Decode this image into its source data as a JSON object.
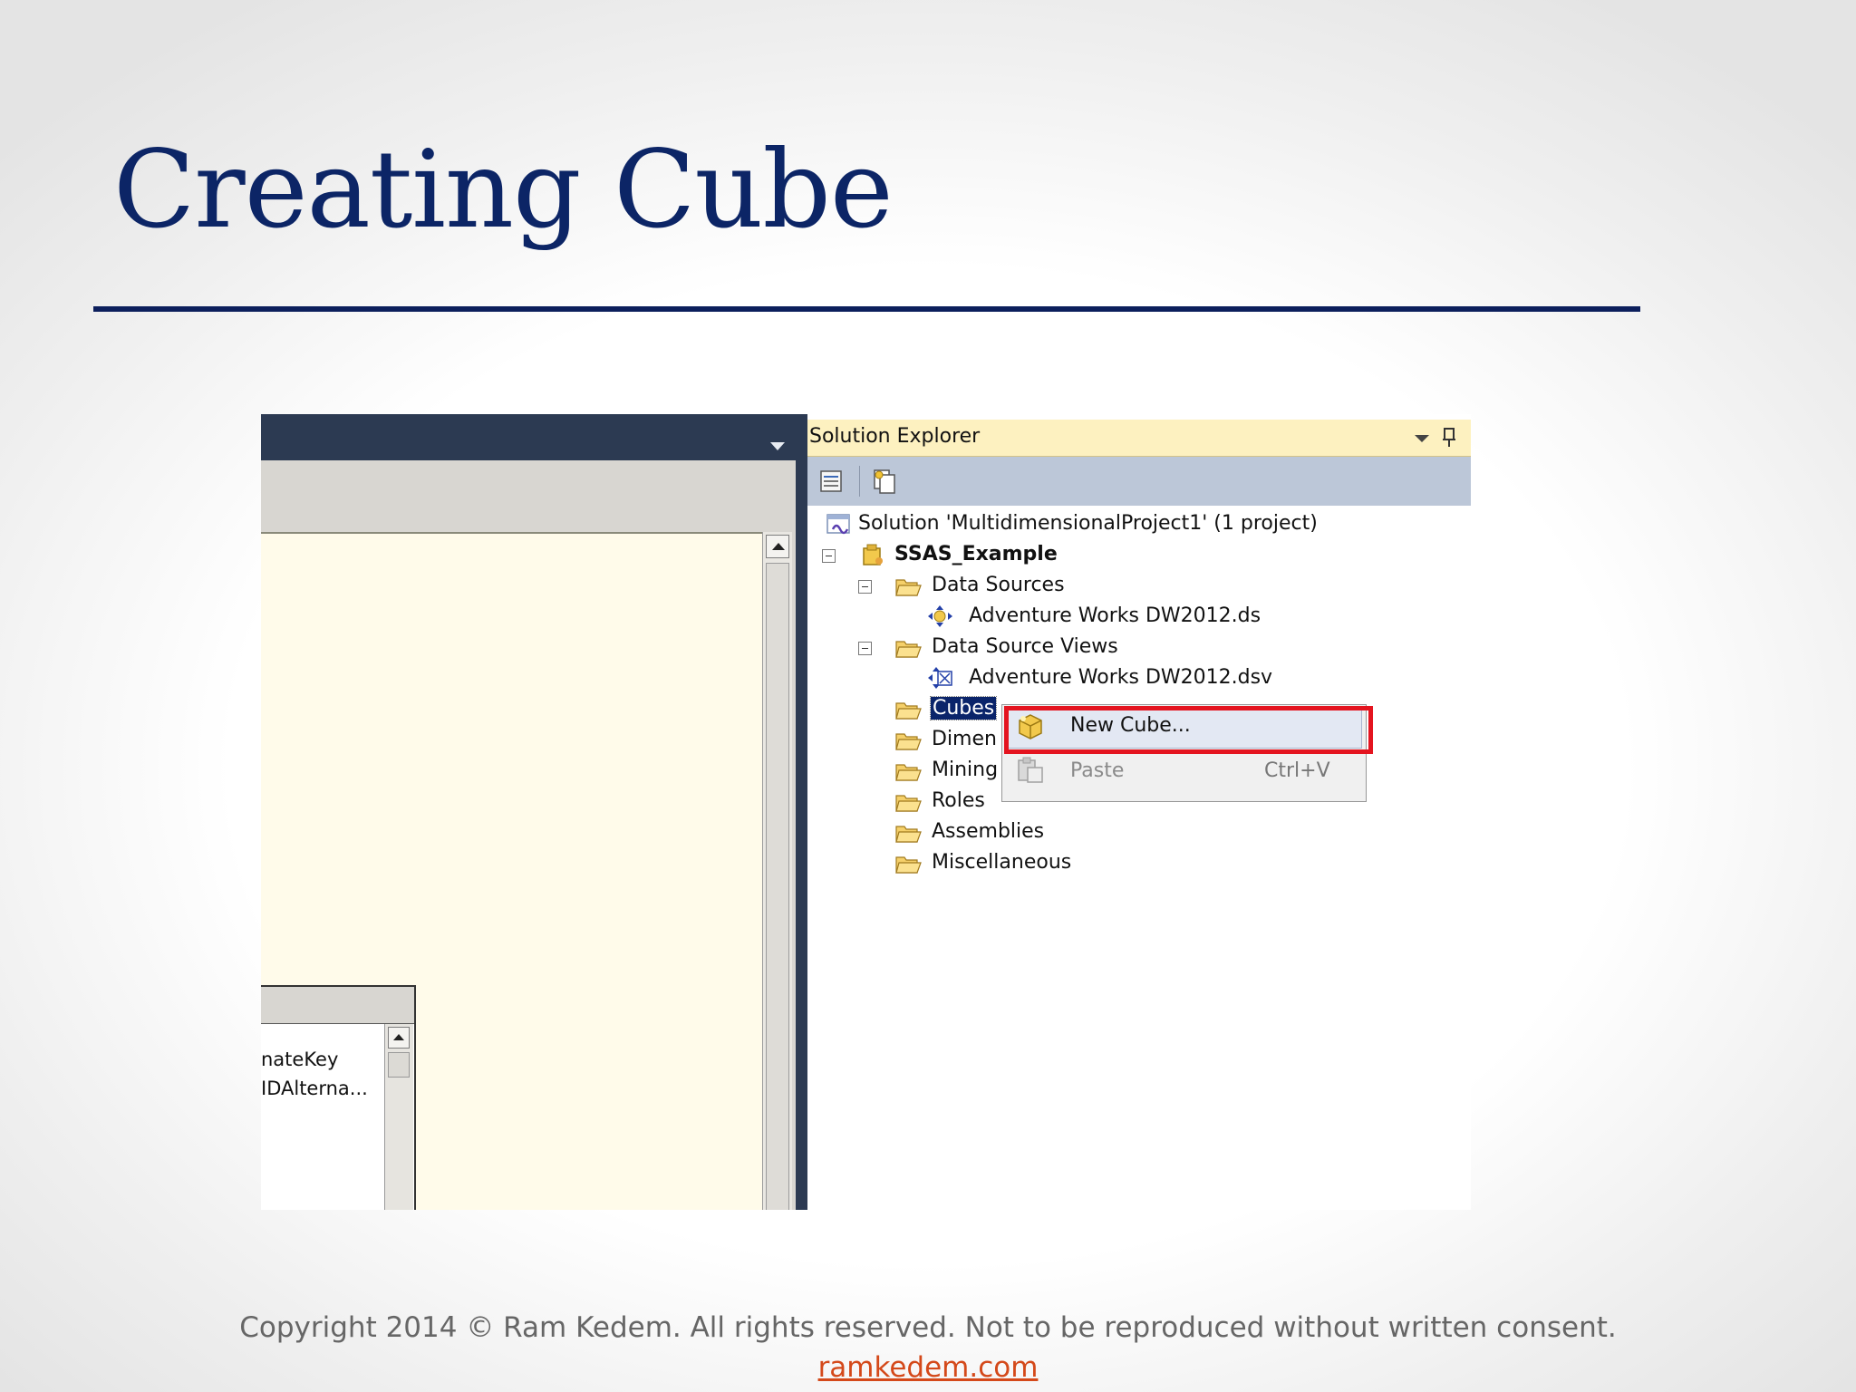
{
  "slide": {
    "title": "Creating Cube"
  },
  "left_pane": {
    "text_lines": [
      "nateKey",
      "IDAlterna..."
    ]
  },
  "solution_explorer": {
    "title": "Solution Explorer",
    "tree": [
      {
        "label": "Solution 'MultidimensionalProject1' (1 project)",
        "icon": "solution-icon"
      },
      {
        "label": "SSAS_Example",
        "icon": "project-icon"
      },
      {
        "label": "Data Sources",
        "icon": "folder-open-icon"
      },
      {
        "label": "Adventure Works DW2012.ds",
        "icon": "data-source-icon"
      },
      {
        "label": "Data Source Views",
        "icon": "folder-open-icon"
      },
      {
        "label": "Adventure Works DW2012.dsv",
        "icon": "data-source-view-icon"
      },
      {
        "label": "Cubes",
        "icon": "folder-open-icon"
      },
      {
        "label": "Dimen",
        "icon": "folder-open-icon"
      },
      {
        "label": "Mining",
        "icon": "folder-open-icon"
      },
      {
        "label": "Roles",
        "icon": "folder-open-icon"
      },
      {
        "label": "Assemblies",
        "icon": "folder-open-icon"
      },
      {
        "label": "Miscellaneous",
        "icon": "folder-open-icon"
      }
    ]
  },
  "context_menu": {
    "items": [
      {
        "label": "New Cube...",
        "shortcut": "",
        "icon": "cube-icon"
      },
      {
        "label": "Paste",
        "shortcut": "Ctrl+V",
        "icon": "paste-icon"
      }
    ]
  },
  "footer": {
    "copyright": "Copyright 2014 © Ram Kedem. All rights reserved. Not to be reproduced without written consent.",
    "link": "ramkedem.com"
  },
  "colors": {
    "title": "#0c2566",
    "ide_dark": "#2c3a52",
    "highlight_box": "#e4141f",
    "link": "#d4491a"
  }
}
